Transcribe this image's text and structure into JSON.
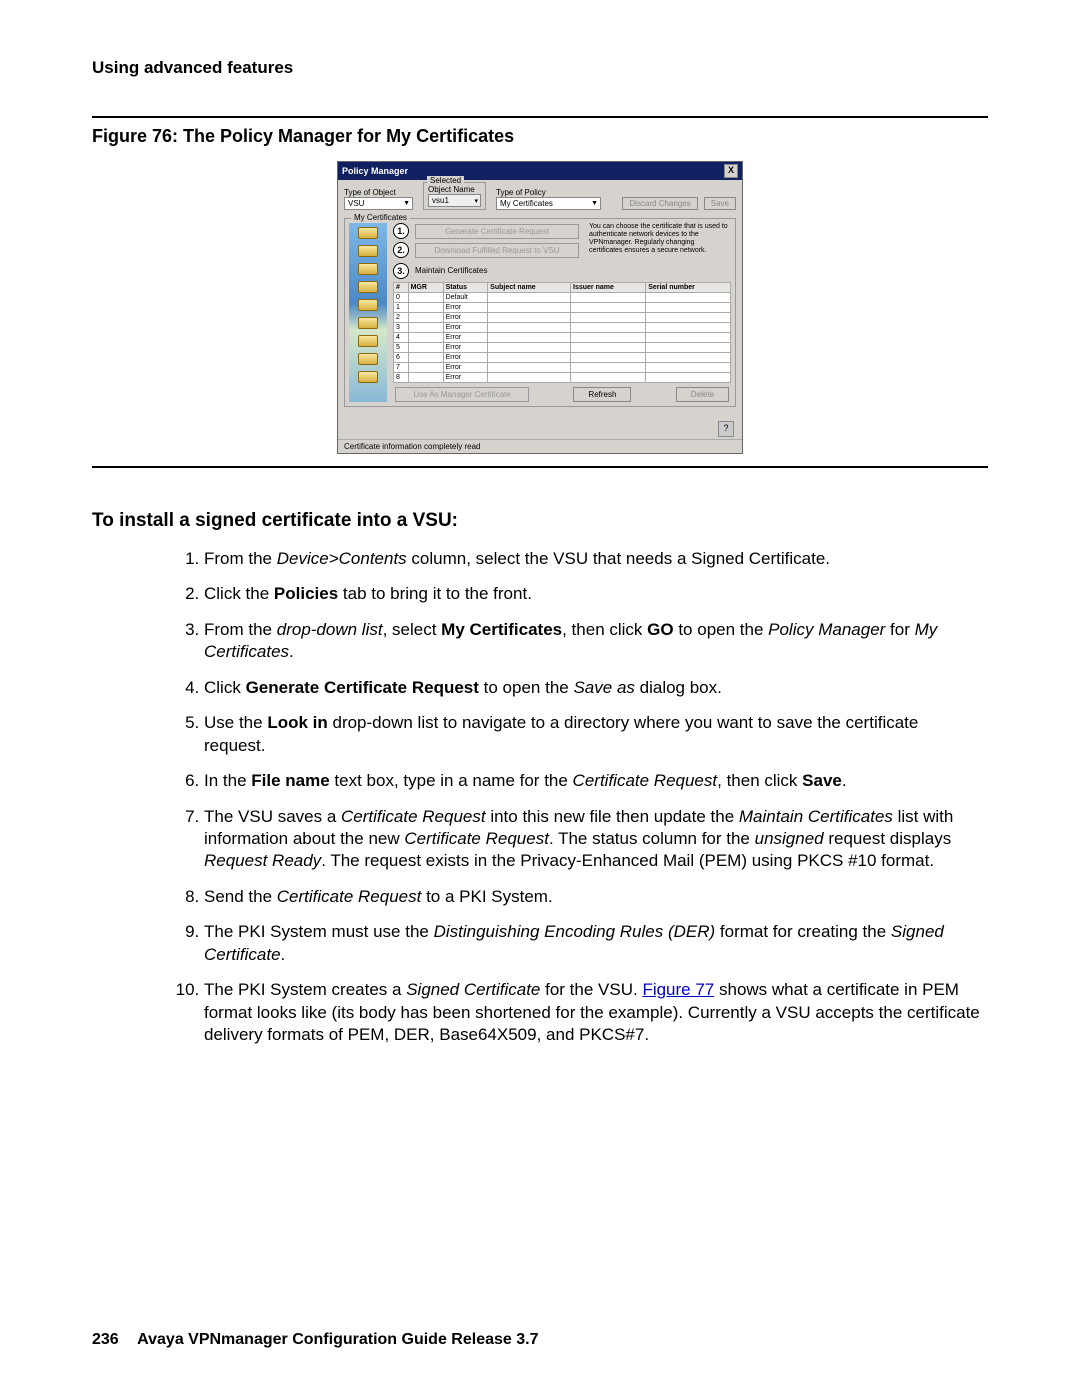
{
  "page_header": "Using advanced features",
  "figure": {
    "caption": "Figure 76: The Policy Manager for My Certificates",
    "window": {
      "title": "Policy Manager",
      "close_label": "X",
      "top": {
        "type_of_object_label": "Type of Object",
        "type_of_object_value": "VSU",
        "selected_label": "Selected",
        "object_name_label": "Object Name",
        "object_name_value": "vsu1",
        "type_of_policy_label": "Type of Policy",
        "type_of_policy_value": "My Certificates",
        "discard_btn": "Discard Changes",
        "save_btn": "Save"
      },
      "group_label": "My Certificates",
      "step1_btn": "Generate Certificate Request",
      "step2_btn": "Download Fulfilled Request to VSU",
      "step3_title": "Maintain Certificates",
      "help_text": "You can choose the certificate that is used to authenticate network devices to the VPNmanager. Regularly changing certificates ensures a secure network.",
      "table": {
        "headers": [
          "#",
          "MGR",
          "Status",
          "Subject name",
          "Issuer name",
          "Serial number"
        ],
        "rows": [
          [
            "0",
            "",
            "Default",
            "",
            "",
            ""
          ],
          [
            "1",
            "",
            "Error",
            "",
            "",
            ""
          ],
          [
            "2",
            "",
            "Error",
            "",
            "",
            ""
          ],
          [
            "3",
            "",
            "Error",
            "",
            "",
            ""
          ],
          [
            "4",
            "",
            "Error",
            "",
            "",
            ""
          ],
          [
            "5",
            "",
            "Error",
            "",
            "",
            ""
          ],
          [
            "6",
            "",
            "Error",
            "",
            "",
            ""
          ],
          [
            "7",
            "",
            "Error",
            "",
            "",
            ""
          ],
          [
            "8",
            "",
            "Error",
            "",
            "",
            ""
          ]
        ]
      },
      "bottom_buttons": {
        "use_as_mgr": "Use As Manager Certificate",
        "refresh": "Refresh",
        "delete": "Delete"
      },
      "help_icon": "?",
      "status_bar": "Certificate information completely read"
    }
  },
  "section_heading": "To install a signed certificate into a VSU:",
  "steps": [
    [
      {
        "t": "From the "
      },
      {
        "t": "Device>Contents",
        "i": true
      },
      {
        "t": " column, select the VSU that needs a Signed Certificate."
      }
    ],
    [
      {
        "t": "Click the "
      },
      {
        "t": "Policies",
        "b": true
      },
      {
        "t": " tab to bring it to the front."
      }
    ],
    [
      {
        "t": "From the "
      },
      {
        "t": "drop-down list",
        "i": true
      },
      {
        "t": ", select "
      },
      {
        "t": "My Certificates",
        "b": true
      },
      {
        "t": ", then click "
      },
      {
        "t": "GO",
        "b": true
      },
      {
        "t": " to open the "
      },
      {
        "t": "Policy Manager",
        "i": true
      },
      {
        "t": " for "
      },
      {
        "t": "My Certificates",
        "i": true
      },
      {
        "t": "."
      }
    ],
    [
      {
        "t": "Click "
      },
      {
        "t": "Generate Certificate Request",
        "b": true
      },
      {
        "t": " to open the "
      },
      {
        "t": "Save as",
        "i": true
      },
      {
        "t": " dialog box."
      }
    ],
    [
      {
        "t": "Use the "
      },
      {
        "t": "Look in",
        "b": true
      },
      {
        "t": " drop-down list to navigate to a directory where you want to save the certificate request."
      }
    ],
    [
      {
        "t": "In the "
      },
      {
        "t": "File name",
        "b": true
      },
      {
        "t": " text box, type in a name for the "
      },
      {
        "t": "Certificate Request",
        "i": true
      },
      {
        "t": ", then click "
      },
      {
        "t": "Save",
        "b": true
      },
      {
        "t": "."
      }
    ],
    [
      {
        "t": "The VSU saves a "
      },
      {
        "t": "Certificate Request",
        "i": true
      },
      {
        "t": " into this new file then update the "
      },
      {
        "t": "Maintain Certificates",
        "i": true
      },
      {
        "t": " list with information about the new "
      },
      {
        "t": "Certificate Request",
        "i": true
      },
      {
        "t": ". The status column for the "
      },
      {
        "t": "unsigned",
        "i": true
      },
      {
        "t": " request displays "
      },
      {
        "t": "Request Ready",
        "i": true
      },
      {
        "t": ". The request exists in the Privacy-Enhanced Mail (PEM) using PKCS #10 format."
      }
    ],
    [
      {
        "t": "Send the "
      },
      {
        "t": "Certificate Request",
        "i": true
      },
      {
        "t": " to a PKI System."
      }
    ],
    [
      {
        "t": "The PKI System must use the "
      },
      {
        "t": "Distinguishing Encoding Rules (DER)",
        "i": true
      },
      {
        "t": " format for creating the "
      },
      {
        "t": "Signed Certificate",
        "i": true
      },
      {
        "t": "."
      }
    ],
    [
      {
        "t": "The PKI System creates a "
      },
      {
        "t": "Signed Certificate",
        "i": true
      },
      {
        "t": " for the VSU. "
      },
      {
        "t": "Figure 77",
        "link": true
      },
      {
        "t": " shows what a certificate in PEM format looks like (its body has been shortened for the example). Currently a VSU accepts the certificate delivery formats of PEM, DER, Base64X509, and PKCS#7."
      }
    ]
  ],
  "footer": {
    "page_number": "236",
    "text": "Avaya VPNmanager Configuration Guide Release 3.7"
  }
}
